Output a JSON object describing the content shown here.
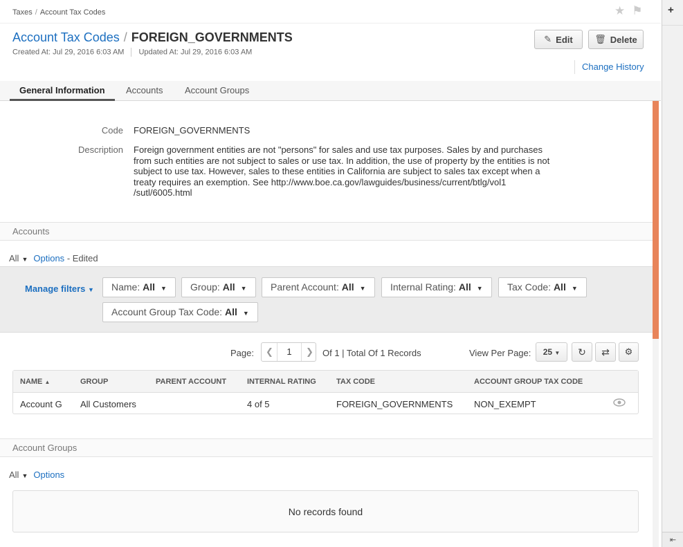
{
  "breadcrumb": [
    "Taxes",
    "Account Tax Codes"
  ],
  "header": {
    "parent_link": "Account Tax Codes",
    "current": "FOREIGN_GOVERNMENTS",
    "created": "Created At: Jul 29, 2016 6:03 AM",
    "updated": "Updated At: Jul 29, 2016 6:03 AM",
    "edit_label": "Edit",
    "delete_label": "Delete",
    "change_history": "Change History"
  },
  "tabs": [
    {
      "label": "General Information",
      "active": true
    },
    {
      "label": "Accounts",
      "active": false
    },
    {
      "label": "Account Groups",
      "active": false
    }
  ],
  "general": {
    "code_label": "Code",
    "code_value": "FOREIGN_GOVERNMENTS",
    "description_label": "Description",
    "description_lines": [
      "Foreign government entities are not \"persons\" for sales and use tax purposes. Sales by and purchases",
      "from such entities are not subject to sales or use tax. In addition, the use of property by the entities is not",
      "subject to use tax. However, sales to these entities in California are subject to sales tax except when a",
      "treaty requires an exemption. See http://www.boe.ca.gov/lawguides/business/current/btlg/vol1",
      "/sutl/6005.html"
    ]
  },
  "accounts": {
    "section_title": "Accounts",
    "view": "All",
    "options": "Options",
    "edited": "- Edited",
    "manage_filters": "Manage filters",
    "filters": [
      {
        "name": "Name:",
        "value": "All"
      },
      {
        "name": "Group:",
        "value": "All"
      },
      {
        "name": "Parent Account:",
        "value": "All"
      },
      {
        "name": "Internal Rating:",
        "value": "All"
      },
      {
        "name": "Tax Code:",
        "value": "All"
      },
      {
        "name": "Account Group Tax Code:",
        "value": "All"
      }
    ],
    "pager": {
      "page_label": "Page:",
      "page": "1",
      "of": "Of 1 | Total Of 1 Records",
      "view_per_page": "View Per Page:",
      "per_page": "25"
    },
    "columns": [
      "NAME",
      "GROUP",
      "PARENT ACCOUNT",
      "INTERNAL RATING",
      "TAX CODE",
      "ACCOUNT GROUP TAX CODE"
    ],
    "rows": [
      {
        "name": "Account G",
        "group": "All Customers",
        "parent": "",
        "rating": "4 of 5",
        "tax_code": "FOREIGN_GOVERNMENTS",
        "group_tax_code": "NON_EXEMPT"
      }
    ]
  },
  "account_groups": {
    "section_title": "Account Groups",
    "view": "All",
    "options": "Options",
    "empty": "No records found"
  }
}
